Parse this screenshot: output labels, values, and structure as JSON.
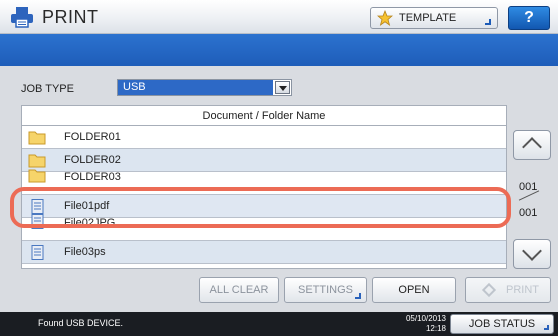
{
  "header": {
    "title": "PRINT",
    "template_label": "TEMPLATE",
    "help_label": "?"
  },
  "job_type": {
    "label": "JOB TYPE",
    "value": "USB"
  },
  "list": {
    "column_header": "Document / Folder Name",
    "rows": [
      {
        "name": "FOLDER01",
        "type": "folder"
      },
      {
        "name": "FOLDER02",
        "type": "folder"
      },
      {
        "name": "FOLDER03",
        "type": "folder"
      },
      {
        "name": "File01pdf",
        "type": "file",
        "selected": true
      },
      {
        "name": "File02JPG",
        "type": "file"
      },
      {
        "name": "File03ps",
        "type": "file"
      }
    ]
  },
  "pager": {
    "current": "001",
    "total": "001"
  },
  "buttons": {
    "all_clear": "ALL CLEAR",
    "settings": "SETTINGS",
    "open": "OPEN",
    "print": "PRINT"
  },
  "status": {
    "message": "Found USB DEVICE.",
    "date": "05/10/2013",
    "time": "12:18",
    "job_status": "JOB STATUS"
  },
  "colors": {
    "accent_blue": "#1e5db9",
    "highlight": "#ec6b55",
    "folder": "#f3c54e"
  }
}
